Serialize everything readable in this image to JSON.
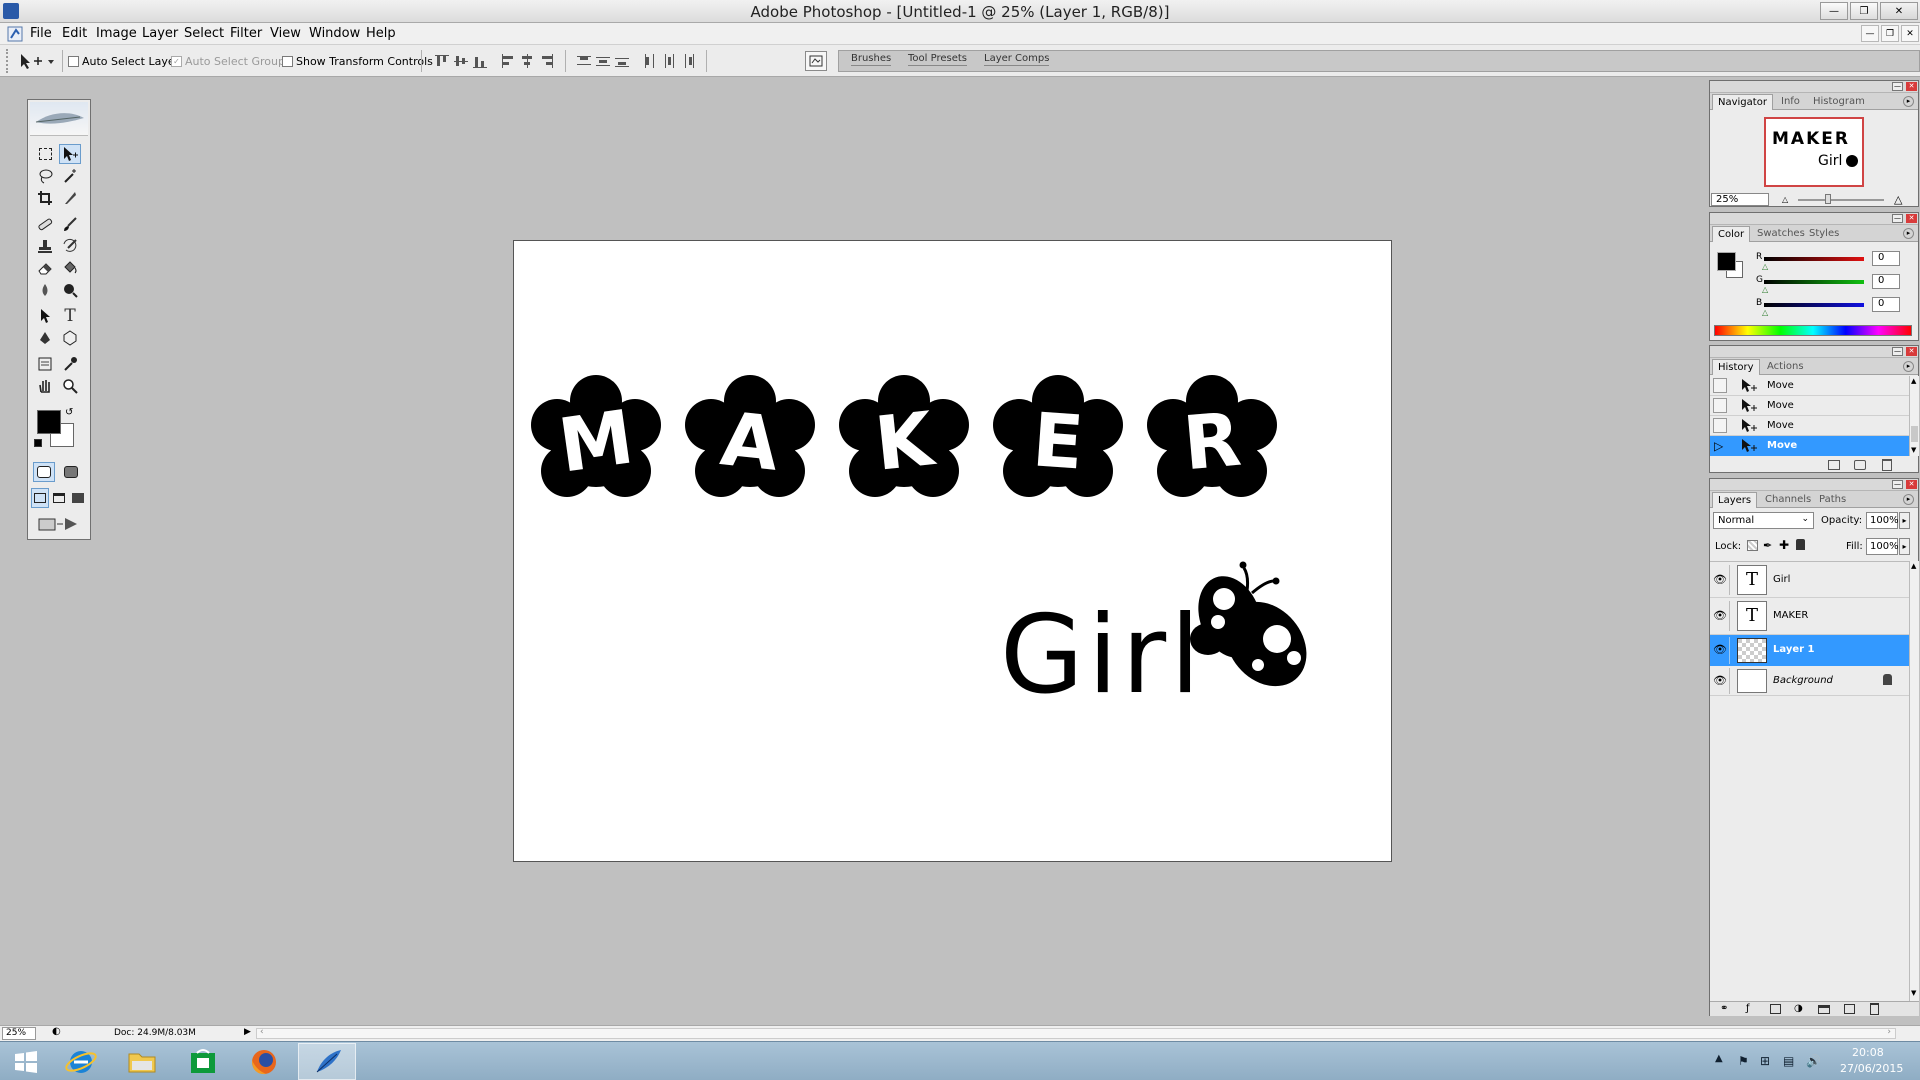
{
  "window": {
    "title": "Adobe Photoshop - [Untitled-1 @ 25% (Layer 1, RGB/8)]"
  },
  "menu": [
    "File",
    "Edit",
    "Image",
    "Layer",
    "Select",
    "Filter",
    "View",
    "Window",
    "Help"
  ],
  "options": {
    "auto_select_layer": "Auto Select Layer",
    "auto_select_groups": "Auto Select Groups",
    "show_transform_controls": "Show Transform Controls",
    "well_tabs": [
      "Brushes",
      "Tool Presets",
      "Layer Comps"
    ]
  },
  "canvas": {
    "title_text": "MAKER",
    "letters": [
      "M",
      "A",
      "K",
      "E",
      "R"
    ],
    "subtitle_text": "Girl"
  },
  "navigator": {
    "tabs": [
      "Navigator",
      "Info",
      "Histogram"
    ],
    "zoom": "25%",
    "thumb_title": "MAKER",
    "thumb_sub": "Girl"
  },
  "color": {
    "tabs": [
      "Color",
      "Swatches",
      "Styles"
    ],
    "channels": [
      {
        "label": "R",
        "value": "0",
        "color": "#d21b1b"
      },
      {
        "label": "G",
        "value": "0",
        "color": "#1aa11a"
      },
      {
        "label": "B",
        "value": "0",
        "color": "#1a1acf"
      }
    ]
  },
  "history": {
    "tabs": [
      "History",
      "Actions"
    ],
    "items": [
      "Move",
      "Move",
      "Move",
      "Move"
    ],
    "selected_index": 3
  },
  "layers": {
    "tabs": [
      "Layers",
      "Channels",
      "Paths"
    ],
    "blend_mode": "Normal",
    "opacity_label": "Opacity:",
    "opacity": "100%",
    "lock_label": "Lock:",
    "fill_label": "Fill:",
    "fill": "100%",
    "items": [
      {
        "name": "Girl",
        "kind": "text"
      },
      {
        "name": "MAKER",
        "kind": "text"
      },
      {
        "name": "Layer 1",
        "kind": "pixel",
        "selected": true
      },
      {
        "name": "Background",
        "kind": "background",
        "locked": true
      }
    ]
  },
  "status": {
    "zoom": "25%",
    "doc": "Doc: 24.9M/8.03M"
  },
  "taskbar": {
    "time": "20:08",
    "date": "27/06/2015"
  },
  "accent": "#3399ff"
}
